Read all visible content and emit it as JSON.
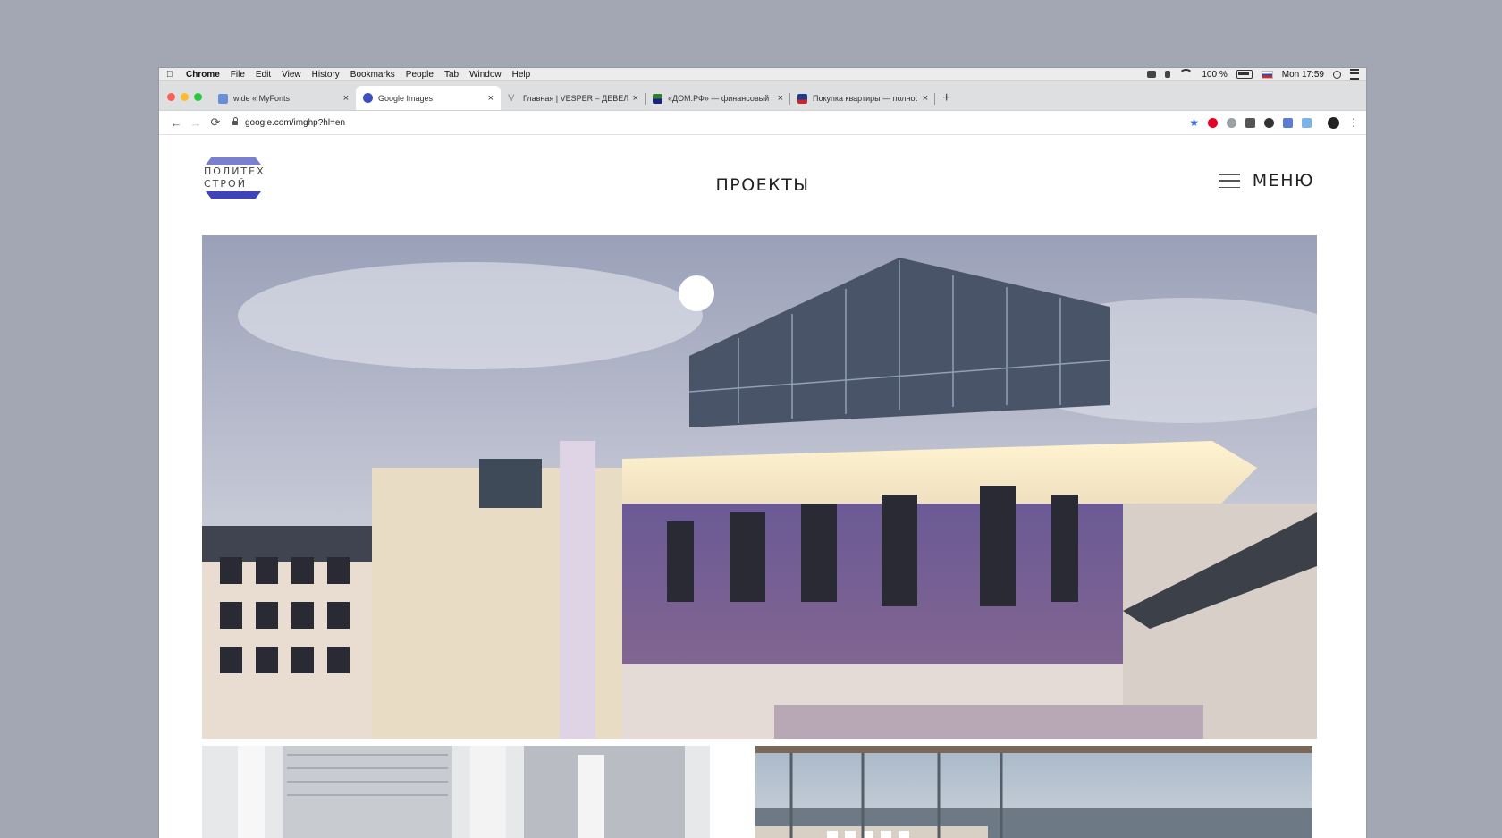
{
  "menubar": {
    "app": "Chrome",
    "items": [
      "File",
      "Edit",
      "View",
      "History",
      "Bookmarks",
      "People",
      "Tab",
      "Window",
      "Help"
    ],
    "battery": "100 %",
    "clock": "Mon 17:59"
  },
  "tabs": [
    {
      "title": "wide « MyFonts",
      "active": false
    },
    {
      "title": "Google Images",
      "active": true
    },
    {
      "title": "Главная | VESPER – ДЕВЕЛОП",
      "active": false
    },
    {
      "title": "«ДОМ.РФ» — финансовый и",
      "active": false
    },
    {
      "title": "Покупка квартиры — полнос",
      "active": false
    }
  ],
  "address": "google.com/imghp?hl=en",
  "site": {
    "logo_line1": "ПОЛИТЕХ",
    "logo_line2": "СТРОЙ",
    "title": "ПРОЕКТЫ",
    "menu": "МЕНЮ"
  },
  "colors": {
    "brand_light": "#7a7fd0",
    "brand_dark": "#3f43b8",
    "background": "#a3a7b3"
  }
}
